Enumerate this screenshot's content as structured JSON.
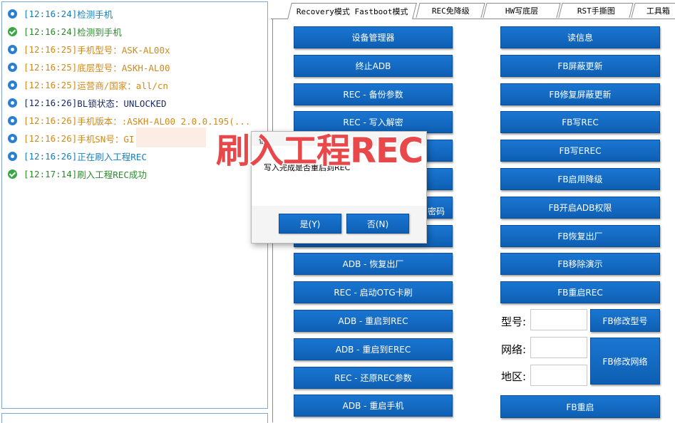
{
  "log": {
    "lines": [
      {
        "icon": "info",
        "color": "blue",
        "time": "[12:16:24]",
        "text": "检测手机"
      },
      {
        "icon": "ok",
        "color": "green",
        "time": "[12:16:24]",
        "text": "检测到手机"
      },
      {
        "icon": "info",
        "color": "orange",
        "time": "[12:16:25]",
        "text": "手机型号：ASK-AL00x"
      },
      {
        "icon": "info",
        "color": "orange",
        "time": "[12:16:25]",
        "text": "底层型号：ASKH-AL00"
      },
      {
        "icon": "info",
        "color": "orange",
        "time": "[12:16:25]",
        "text": "运营商/国家：all/cn"
      },
      {
        "icon": "info",
        "color": "dark",
        "time": "[12:16:26]",
        "text": "BL锁状态：UNLOCKED"
      },
      {
        "icon": "info",
        "color": "orange",
        "time": "[12:16:26]",
        "text": "手机版本：:ASKH-AL00 2.0.0.195(..."
      },
      {
        "icon": "info",
        "color": "orange",
        "time": "[12:16:26]",
        "text": "手机SN号：GI"
      },
      {
        "icon": "info",
        "color": "blue",
        "time": "[12:16:26]",
        "text": "正在刷入工程REC"
      },
      {
        "icon": "ok",
        "color": "green",
        "time": "[12:17:14]",
        "text": "刷入工程REC成功"
      }
    ]
  },
  "tabs": [
    "Recovery模式 Fastboot模式",
    "REC免降级",
    "HW写底层",
    "RST手撕图",
    "工具箱"
  ],
  "left_buttons": [
    "设备管理器",
    "终止ADB",
    "REC - 备份参数",
    "REC - 写入解密",
    "",
    "",
    "",
    "",
    "ADB - 恢复出厂",
    "REC - 启动OTG卡刷",
    "ADB - 重启到REC",
    "ADB - 重启到EREC",
    "REC - 还原REC参数",
    "ADB - 重启手机"
  ],
  "left_fragments": {
    "b5": "信",
    "b7": "密码"
  },
  "right_buttons": [
    "读信息",
    "FB屏蔽更新",
    "FB修复屏蔽更新",
    "FB写REC",
    "FB写EREC",
    "FB启用降级",
    "FB开启ADB权限",
    "FB恢复出厂",
    "FB移除演示",
    "FB重启REC"
  ],
  "fields": {
    "model_label": "型号:",
    "network_label": "网络:",
    "region_label": "地区:",
    "model_button": "FB修改型号",
    "network_button": "FB修改网络"
  },
  "bottom_button": "FB重启",
  "overlay_text": "刷入工程REC",
  "dialog": {
    "message": "写入完成是否重启到REC",
    "yes": "是(Y)",
    "no": "否(N)"
  }
}
